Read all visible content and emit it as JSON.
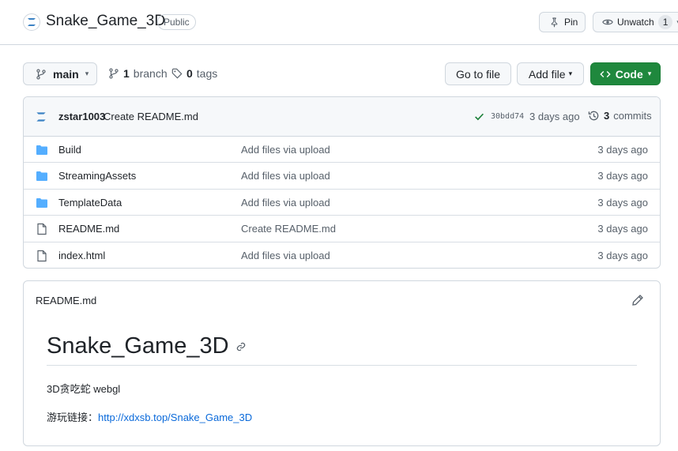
{
  "repo": {
    "name": "Snake_Game_3D",
    "visibility": "Public"
  },
  "actions": {
    "pin_label": "Pin",
    "unwatch_label": "Unwatch",
    "watch_count": "1"
  },
  "nav": {
    "branch": "main",
    "branch_count": "1",
    "branch_word": "branch",
    "tag_count": "0",
    "tag_word": "tags",
    "goto_file": "Go to file",
    "add_file": "Add file",
    "code": "Code"
  },
  "commit": {
    "author": "zstar1003",
    "message": "Create README.md",
    "hash": "30bdd74",
    "time": "3 days ago",
    "commit_count": "3",
    "commit_word": "commits"
  },
  "files": [
    {
      "type": "folder",
      "name": "Build",
      "commit": "Add files via upload",
      "age": "3 days ago"
    },
    {
      "type": "folder",
      "name": "StreamingAssets",
      "commit": "Add files via upload",
      "age": "3 days ago"
    },
    {
      "type": "folder",
      "name": "TemplateData",
      "commit": "Add files via upload",
      "age": "3 days ago"
    },
    {
      "type": "file",
      "name": "README.md",
      "commit": "Create README.md",
      "age": "3 days ago"
    },
    {
      "type": "file",
      "name": "index.html",
      "commit": "Add files via upload",
      "age": "3 days ago"
    }
  ],
  "readme": {
    "label": "README.md",
    "heading": "Snake_Game_3D",
    "line1": "3D贪吃蛇 webgl",
    "line2_prefix": "游玩链接：",
    "link": "http://xdxsb.top/Snake_Game_3D"
  },
  "colors": {
    "accent": "#1f883d",
    "link": "#0969da",
    "folder": "#54aeff"
  }
}
